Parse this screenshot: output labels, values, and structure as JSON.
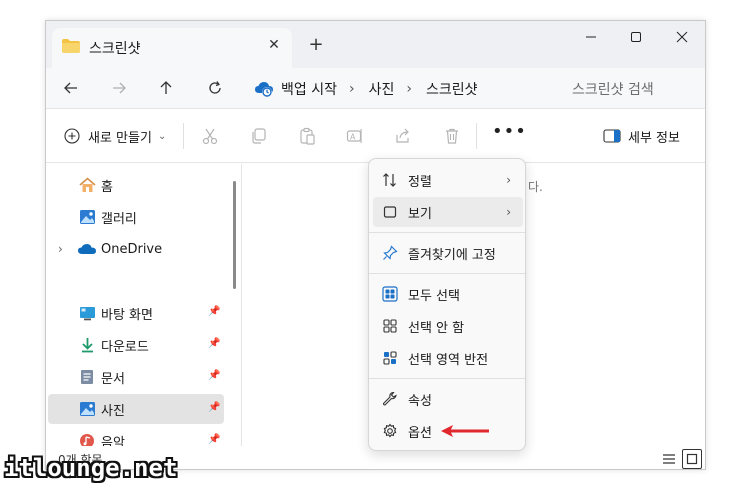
{
  "window": {
    "tab_title": "스크린샷",
    "tab_icon": "folder-icon",
    "controls": [
      "minimize-icon",
      "maximize-icon",
      "close-icon"
    ]
  },
  "nav": {
    "buttons": [
      "back-icon",
      "forward-icon",
      "up-icon",
      "refresh-icon"
    ],
    "backup_label": "백업 시작",
    "breadcrumbs": [
      "사진",
      "스크린샷"
    ],
    "search_placeholder": "스크린샷 검색"
  },
  "commandbar": {
    "new_label": "새로 만들기",
    "tools": [
      "cut-icon",
      "copy-icon",
      "paste-icon",
      "rename-icon",
      "share-icon",
      "delete-icon"
    ],
    "more_label": "•••",
    "details_label": "세부 정보"
  },
  "sidebar": {
    "items": [
      {
        "label": "홈",
        "icon": "home-icon",
        "pinned": false
      },
      {
        "label": "갤러리",
        "icon": "gallery-icon",
        "pinned": false
      },
      {
        "label": "OneDrive",
        "icon": "cloud-icon",
        "pinned": false,
        "expandable": true
      },
      {
        "label": "바탕 화면",
        "icon": "desktop-icon",
        "pinned": true
      },
      {
        "label": "다운로드",
        "icon": "download-icon",
        "pinned": true
      },
      {
        "label": "문서",
        "icon": "document-icon",
        "pinned": true
      },
      {
        "label": "사진",
        "icon": "picture-icon",
        "pinned": true,
        "selected": true
      },
      {
        "label": "음악",
        "icon": "music-icon",
        "pinned": true
      }
    ]
  },
  "content": {
    "empty_fragment": "다."
  },
  "status": {
    "item_count": "0개 항목"
  },
  "menu": {
    "items": [
      {
        "label": "정렬",
        "icon": "sort-icon",
        "submenu": true
      },
      {
        "label": "보기",
        "icon": "view-icon",
        "submenu": true,
        "hover": true
      },
      {
        "label": "즐겨찾기에 고정",
        "icon": "pin-icon"
      },
      {
        "label": "모두 선택",
        "icon": "select-all-icon"
      },
      {
        "label": "선택 안 함",
        "icon": "select-none-icon"
      },
      {
        "label": "선택 영역 반전",
        "icon": "invert-selection-icon"
      },
      {
        "label": "속성",
        "icon": "wrench-icon"
      },
      {
        "label": "옵션",
        "icon": "settings-icon"
      }
    ]
  },
  "annotation": {
    "arrow_color": "#e0282e"
  },
  "watermark": "itlounge.net"
}
